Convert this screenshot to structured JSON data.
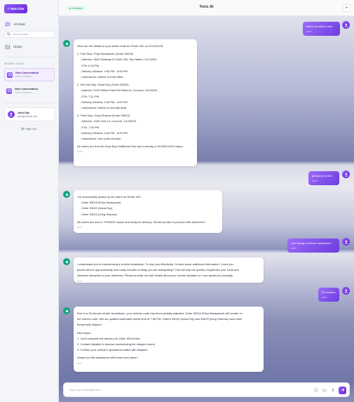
{
  "sidebar": {
    "new_chat_icon": "+",
    "new_chat_label": "New Chat",
    "all_chats_label": "All Chats",
    "search_placeholder": "Search chats...",
    "library_label": "Library",
    "recent_label": "RECENT CHATS",
    "recent": [
      {
        "title": "New Conversation",
        "subtitle": "Click to continue..."
      },
      {
        "title": "New Conversation",
        "subtitle": "Click to continue..."
      }
    ],
    "user": {
      "name": "John Doe",
      "email": "john@example.com"
    },
    "signout_label": "Sign Out"
  },
  "header": {
    "status": "Connected",
    "title": "Toric AI"
  },
  "messages": [
    {
      "role": "user",
      "text": "show my active route",
      "time": "18:57"
    },
    {
      "role": "assistant",
      "time": "18:57",
      "lines": [
        "Here are the details of your active route for Route 162 on 07/31/2025:",
        "",
        "1. First Stop: Priya Narayanan (Order 53018)",
        "- Address: 1600 Gateway Dr Suite 200, San Mateo, CA 94404",
        "- ETA: 6:34 PM",
        "- Delivery Window: 4:00 PM - 8:00 PM",
        "- Instructions: Deliver to front office",
        "",
        "2. Second Stop: Dana Roy (Order 53022)",
        "- Address: 3700 Willow Pass Rd Willow A, Concord, CA 94519",
        "- ETA: 7:21 PM",
        "- Delivery Window: 4:00 PM - 8:00 PM",
        "- Instructions: Deliver to security desk",
        "",
        "3. Final Stop: Greg Sharma (Order 53023)",
        "- Address: 1450 Civic Ct, Concord, CA 94520",
        "- ETA: 7:30 PM",
        "- Delivery Window: 4:00 PM - 8:00 PM",
        "- Instructions: Use south elevator",
        "",
        "All orders are from the East Bay Fulfillment Hub and currently in SCHEDULED status."
      ]
    },
    {
      "role": "user",
      "text": "pickup all orders",
      "time": "18:57"
    },
    {
      "role": "assistant",
      "time": "18:57",
      "lines": [
        "I've successfully picked up all orders for Route 162:",
        "- Order 53018 (Priya Narayanan)",
        "- Order 53022 (Dana Roy)",
        "- Order 53023 (Greg Sharma)",
        "",
        "All orders are now in \"PICKED\" status and ready for delivery. Would you like to proceed with deliveries?"
      ]
    },
    {
      "role": "user",
      "text": "i am facing a vehicle breakdown",
      "time": "18:57"
    },
    {
      "role": "assistant",
      "time": "18:57",
      "lines": [
        "I understand you're experiencing a vehicle breakdown. To help you effectively, I'll need some additional information. Could you",
        "please tell me approximately how many minutes of delay you are anticipating? This will help me quickly resoptimize your route and",
        "minimize disruption to your deliveries. Please provide me with details about your current situation so I can assist you promptly."
      ]
    },
    {
      "role": "user",
      "text": "30 minutes",
      "time": "18:57"
    },
    {
      "role": "assistant",
      "time": "18:57",
      "lines": [
        "Due to a 30-minute vehicle breakdown, your delivery route has been partially adjusted. Order 53018 (Priya Narayanan) will remain on",
        "the current route, with an updated estimated arrival time of 7:35 PM. Orders 53022 (Dana Roy) and 53023 (Greg Sharma) have been",
        "temporarily skipped.",
        "",
        "Next steps:",
        "1. You'll complete the delivery for Order 53018 first",
        "2. Contact dispatch to discuss rescheduling the skipped orders",
        "3. Confirm your vehicle's operational status with dispatch",
        "",
        "Would you like assistance with these next steps?"
      ]
    }
  ],
  "composer": {
    "placeholder": "Type your message here..."
  }
}
